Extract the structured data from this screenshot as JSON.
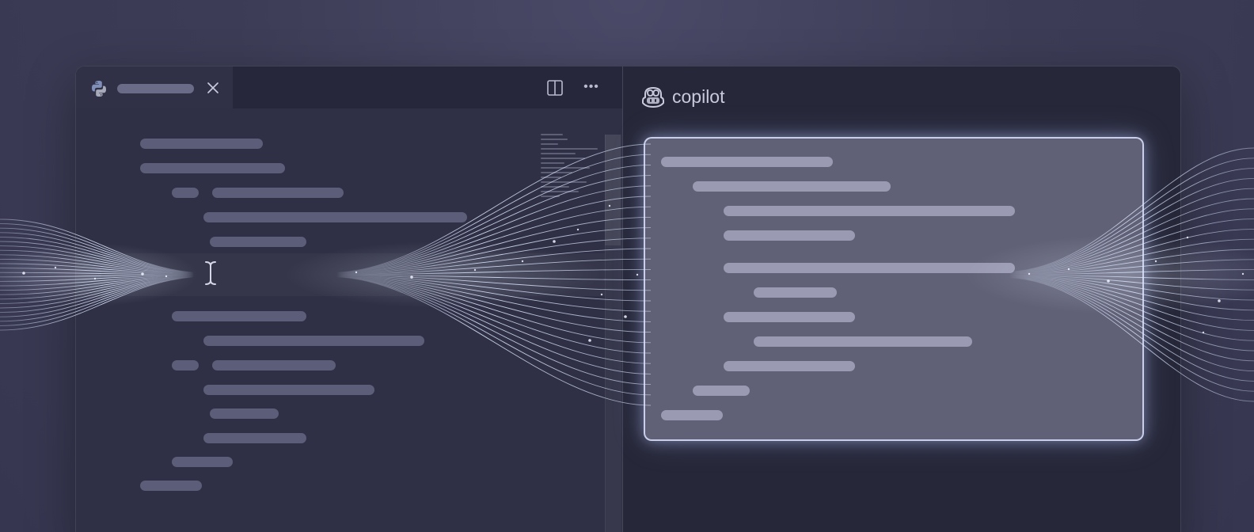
{
  "editor": {
    "tab": {
      "file_icon": "python-icon",
      "close_icon": "close-icon"
    },
    "toolbar": {
      "split_icon": "split-editor-icon",
      "more_icon": "more-actions-icon"
    }
  },
  "copilot": {
    "icon": "copilot-icon",
    "title": "copilot"
  },
  "colors": {
    "background": "#3c3c56",
    "editor_bg": "#2f3045",
    "copilot_bg": "#262738",
    "code_placeholder": "#5c5d78",
    "suggestion_border": "#dce2ff",
    "stream_glow": "#dbe6ff"
  }
}
